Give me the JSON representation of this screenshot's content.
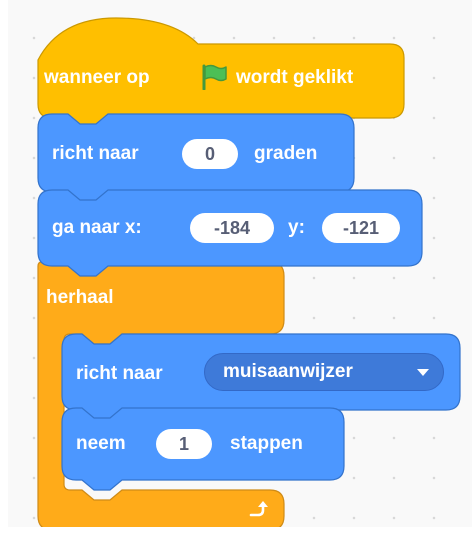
{
  "script": {
    "event_block": {
      "before_flag": "wanneer op",
      "flag_icon": "green-flag-icon",
      "after_flag": "wordt geklikt"
    },
    "point_direction": {
      "label": "richt naar",
      "value": "0",
      "suffix": "graden"
    },
    "goto_xy": {
      "label": "ga naar x:",
      "x": "-184",
      "y_label": "y:",
      "y": "-121"
    },
    "forever": {
      "label": "herhaal",
      "loop_icon": "loop-arrow-icon"
    },
    "point_towards": {
      "label": "richt naar",
      "menu_value": "muisaanwijzer"
    },
    "move_steps": {
      "label": "neem",
      "value": "1",
      "suffix": "stappen"
    }
  },
  "colors": {
    "events": "#ffbf00",
    "motion": "#4c97ff",
    "control": "#ffab19",
    "motion_dark": "#3e7ad9",
    "flag_green": "#4cbf56",
    "workspace": "#f9f9f9"
  }
}
